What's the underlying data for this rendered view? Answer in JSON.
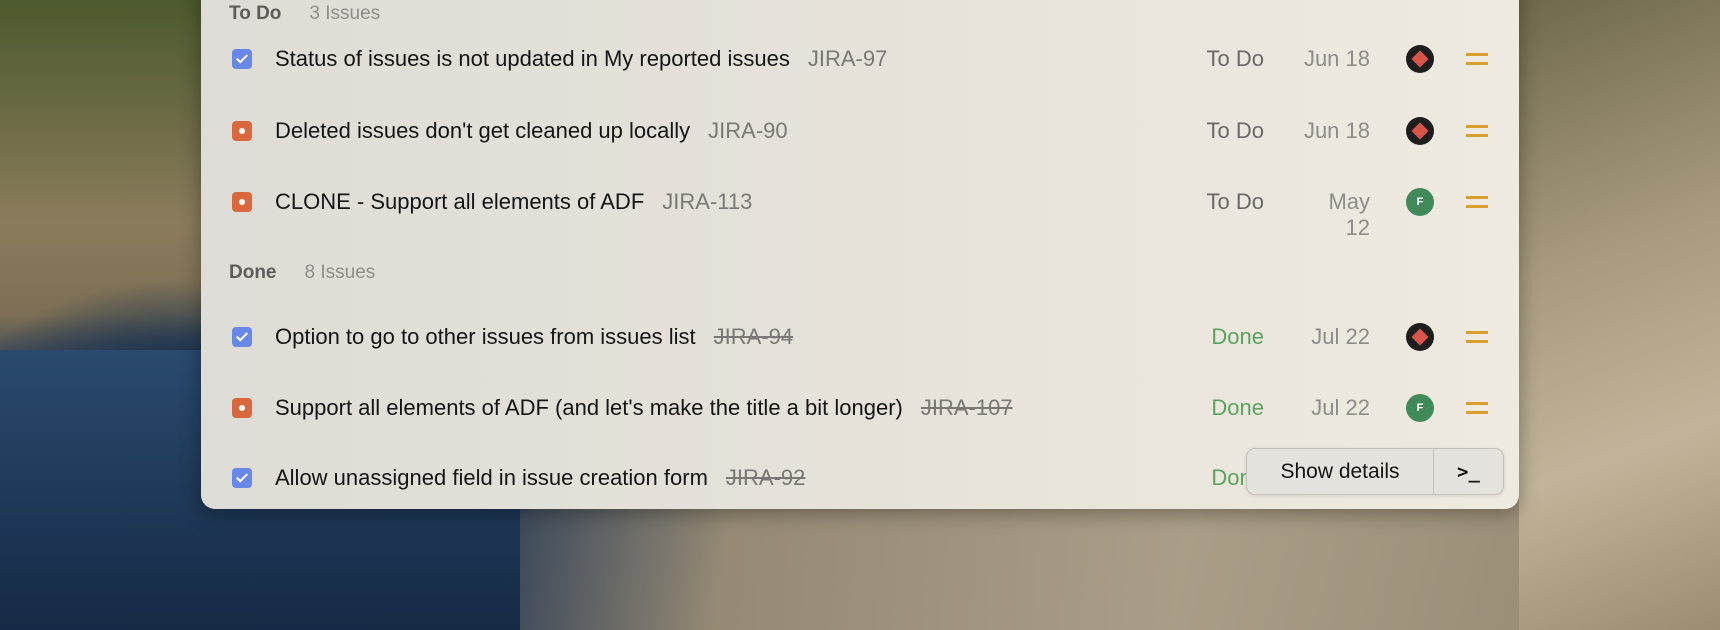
{
  "sections": [
    {
      "name": "To Do",
      "count": "3 Issues",
      "issues": [
        {
          "type": "task",
          "title": "Status of issues is not updated in My reported issues",
          "key": "JIRA-97",
          "status": "To Do",
          "date": "Jun 18",
          "assignee": "dark-avatar",
          "avatar_label": "",
          "priority": "medium"
        },
        {
          "type": "bug",
          "title": "Deleted issues don't get cleaned up locally",
          "key": "JIRA-90",
          "status": "To Do",
          "date": "Jun 18",
          "assignee": "dark-avatar",
          "avatar_label": "",
          "priority": "medium"
        },
        {
          "type": "bug",
          "title": "CLONE - Support all elements of ADF",
          "key": "JIRA-113",
          "status": "To Do",
          "date": "May 12",
          "assignee": "green-avatar",
          "avatar_label": "F",
          "priority": "medium"
        }
      ]
    },
    {
      "name": "Done",
      "count": "8 Issues",
      "issues": [
        {
          "type": "task",
          "title": "Option to go to other issues from issues list",
          "key": "JIRA-94",
          "status": "Done",
          "date": "Jul 22",
          "assignee": "dark-avatar",
          "avatar_label": "",
          "priority": "medium"
        },
        {
          "type": "bug",
          "title": "Support all elements of ADF (and let's make the title a bit longer)",
          "key": "JIRA-107",
          "status": "Done",
          "date": "Jul 22",
          "assignee": "green-avatar",
          "avatar_label": "F",
          "priority": "medium"
        },
        {
          "type": "task",
          "title": "Allow unassigned field in issue creation form",
          "key": "JIRA-92",
          "status": "Done",
          "date": "",
          "assignee": "",
          "avatar_label": "",
          "priority": ""
        }
      ]
    }
  ],
  "action_bar": {
    "primary_label": "Show details",
    "secondary_icon": "terminal-icon",
    "secondary_label": ">_"
  },
  "colors": {
    "task": "#6788e6",
    "bug": "#d9683f",
    "done_status": "#5aa35c",
    "priority_medium": "#d9a030"
  }
}
